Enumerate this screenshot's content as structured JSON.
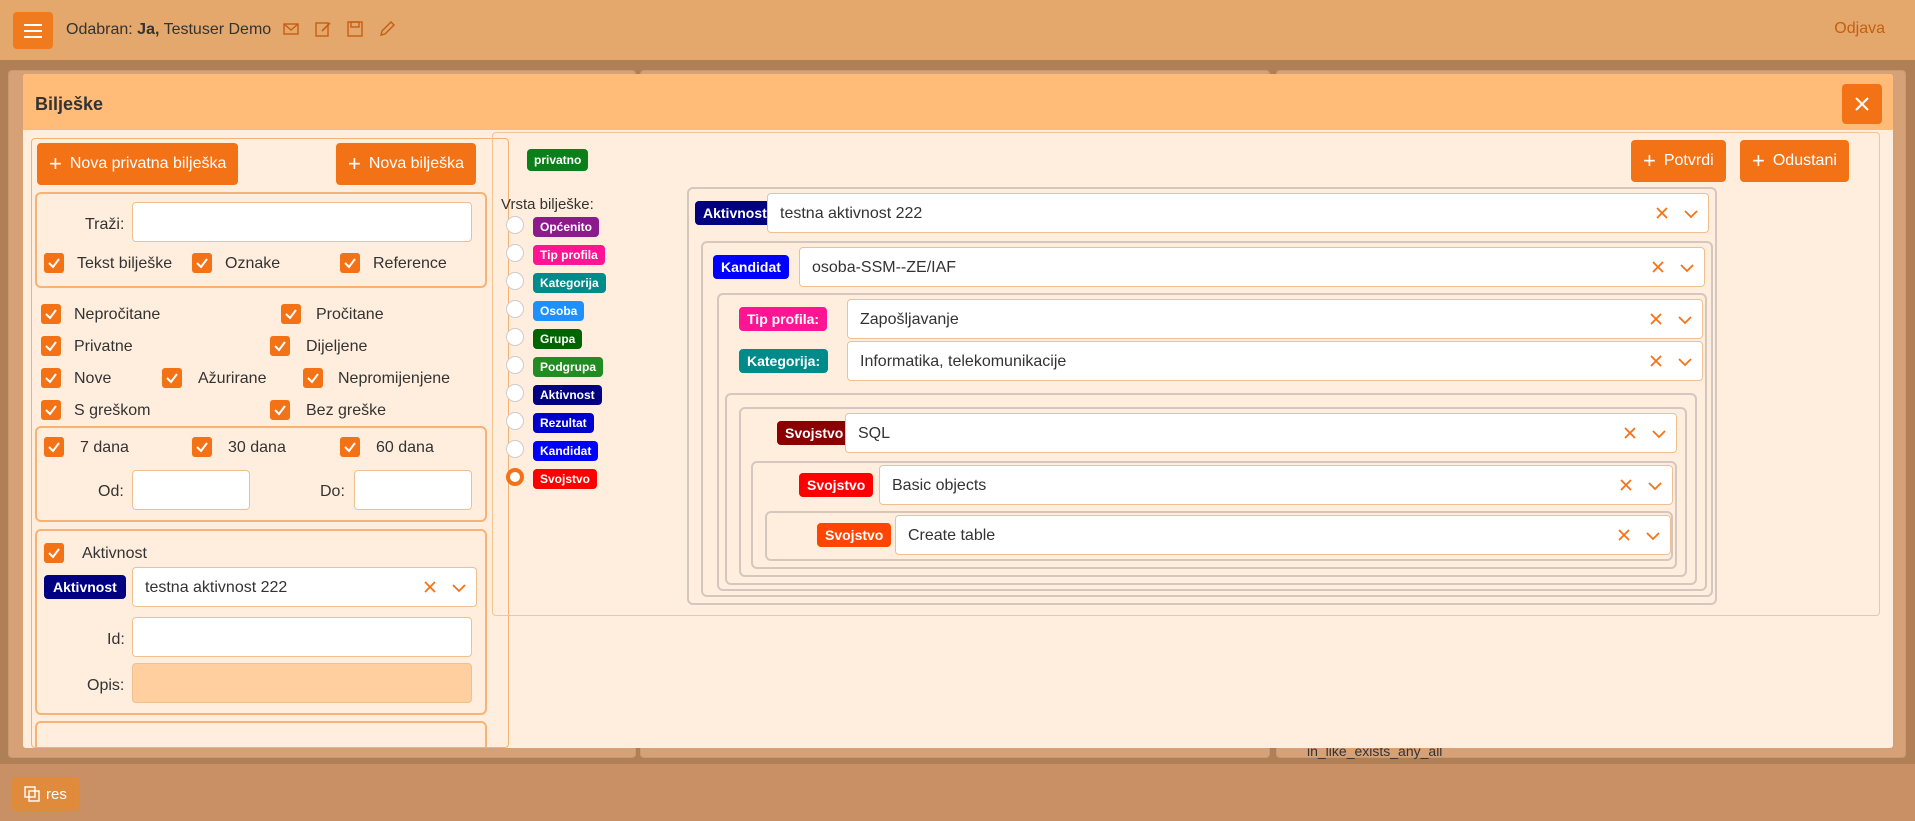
{
  "topbar": {
    "odabran_label": "Odabran:",
    "user_bold": "Ja,",
    "user_name": "Testuser Demo",
    "logout": "Odjava"
  },
  "bottom": {
    "res_label": "res"
  },
  "background": {
    "text_fragment": "in_like_exists_any_all"
  },
  "modal": {
    "title": "Bilješke",
    "new_private_btn": "Nova privatna bilješka",
    "new_note_btn": "Nova bilješka",
    "search": {
      "label": "Traži:",
      "value": ""
    },
    "search_in": [
      {
        "label": "Tekst bilješke",
        "checked": true
      },
      {
        "label": "Oznake",
        "checked": true
      },
      {
        "label": "Reference",
        "checked": true
      }
    ],
    "filters": {
      "neprocitane": "Nepročitane",
      "procitane": "Pročitane",
      "privatne": "Privatne",
      "dijeljene": "Dijeljene",
      "nove": "Nove",
      "azurirane": "Ažurirane",
      "nepromijenjene": "Nepromijenjene",
      "s_greskom": "S greškom",
      "bez_greske": "Bez greške"
    },
    "days": [
      "7 dana",
      "30 dana",
      "60 dana"
    ],
    "od_label": "Od:",
    "do_label": "Do:",
    "aktivnost_check": "Aktivnost",
    "aktivnost_badge": "Aktivnost",
    "aktivnost_value": "testna aktivnost 222",
    "id_label": "Id:",
    "opis_label": "Opis:",
    "privatno_badge": "privatno",
    "potvrdi_btn": "Potvrdi",
    "odustani_btn": "Odustani",
    "vrsta_label": "Vrsta bilješke:",
    "types": [
      {
        "label": "Općenito",
        "color": "#8b1a8b"
      },
      {
        "label": "Tip profila",
        "color": "#ff1493"
      },
      {
        "label": "Kategorija",
        "color": "#008b8b"
      },
      {
        "label": "Osoba",
        "color": "#1e90ff"
      },
      {
        "label": "Grupa",
        "color": "#006400"
      },
      {
        "label": "Podgrupa",
        "color": "#228b22"
      },
      {
        "label": "Aktivnost",
        "color": "#000080"
      },
      {
        "label": "Rezultat",
        "color": "#0000cd"
      },
      {
        "label": "Kandidat",
        "color": "#0000ff"
      },
      {
        "label": "Svojstvo",
        "color": "#ff0000"
      }
    ],
    "tree": {
      "aktivnost_badge": "Aktivnost",
      "aktivnost_value": "testna aktivnost 222",
      "kandidat_badge": "Kandidat",
      "kandidat_value": "osoba-SSM--ZE/IAF",
      "tip_badge": "Tip profila:",
      "tip_value": "Zapošljavanje",
      "kat_badge": "Kategorija:",
      "kat_value": "Informatika, telekomunikacije",
      "svojstvo_badge": "Svojstvo",
      "svojstvo1_value": "SQL",
      "svojstvo2_value": "Basic objects",
      "svojstvo3_value": "Create table"
    }
  }
}
